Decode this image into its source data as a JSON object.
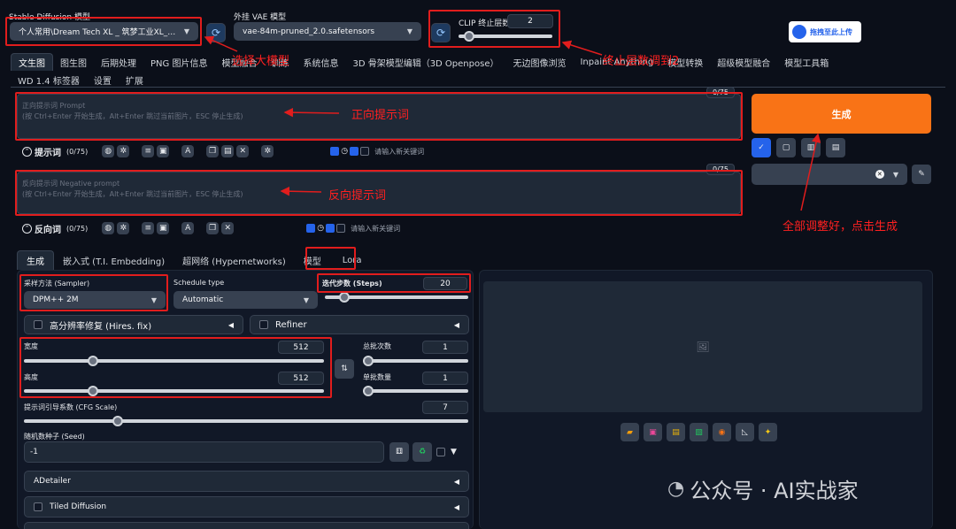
{
  "top": {
    "model_label": "Stable Diffusion 模型",
    "model_value": "个人常用\\Dream Tech XL _ 筑梦工业XL_v5.0 - §",
    "vae_label": "外挂 VAE 模型",
    "vae_value": "vae-84m-pruned_2.0.safetensors",
    "clip_label": "CLIP 终止层数",
    "clip_value": "2",
    "clip_level": 0.1,
    "upload_label": "拖拽至此上传"
  },
  "tabs": [
    "文生图",
    "图生图",
    "后期处理",
    "PNG 图片信息",
    "模型融合",
    "训练",
    "系统信息",
    "3D 骨架模型编辑（3D Openpose）",
    "无边图像浏览",
    "Inpaint Anything",
    "模型转换",
    "超级模型融合",
    "模型工具箱"
  ],
  "tabs2": [
    "WD 1.4 标签器",
    "设置",
    "扩展"
  ],
  "prompt": {
    "counter": "0/75",
    "placeholder1": "正向提示词 Prompt",
    "placeholder2": "(按 Ctrl+Enter 开始生成，Alt+Enter 跳过当前图片，ESC 停止生成)",
    "toolbar_label": "提示词",
    "toolbar_count": "(0/75)",
    "keyword_placeholder": "请输入新关键词"
  },
  "negative": {
    "counter": "0/75",
    "placeholder1": "反向提示词 Negative prompt",
    "placeholder2": "(按 Ctrl+Enter 开始生成，Alt+Enter 跳过当前图片，ESC 停止生成)",
    "toolbar_label": "反向词",
    "toolbar_count": "(0/75)",
    "keyword_placeholder": "请输入新关键词"
  },
  "generate_label": "生成",
  "subtabs": [
    "生成",
    "嵌入式 (T.I. Embedding)",
    "超网络 (Hypernetworks)",
    "模型",
    "Lora"
  ],
  "sampler": {
    "label": "采样方法 (Sampler)",
    "value": "DPM++ 2M"
  },
  "schedule": {
    "label": "Schedule type",
    "value": "Automatic"
  },
  "steps": {
    "label": "迭代步数 (Steps)",
    "value": "20",
    "level": 0.13
  },
  "hires": {
    "label": "高分辨率修复 (Hires. fix)"
  },
  "refiner": {
    "label": "Refiner"
  },
  "width": {
    "label": "宽度",
    "value": "512",
    "level": 0.21
  },
  "height": {
    "label": "高度",
    "value": "512",
    "level": 0.21
  },
  "batch_count": {
    "label": "总批次数",
    "value": "1",
    "level": 0.0
  },
  "batch_size": {
    "label": "单批数量",
    "value": "1",
    "level": 0.0
  },
  "cfg": {
    "label": "提示词引导系数 (CFG Scale)",
    "value": "7",
    "level": 0.2
  },
  "seed": {
    "label": "随机数种子 (Seed)",
    "value": "-1"
  },
  "accordions": [
    "ADetailer",
    "Tiled Diffusion"
  ],
  "annotations": {
    "model": "选择大模型",
    "clip": "终止层数调到2",
    "prompt": "正向提示词",
    "negative": "反向提示词",
    "generate": "全部调整好，点击生成"
  },
  "watermark": "公众号 · AI实战家",
  "colors": {
    "accent": "#f97316",
    "annotation": "#e11d1d",
    "background": "#0b0f19"
  }
}
